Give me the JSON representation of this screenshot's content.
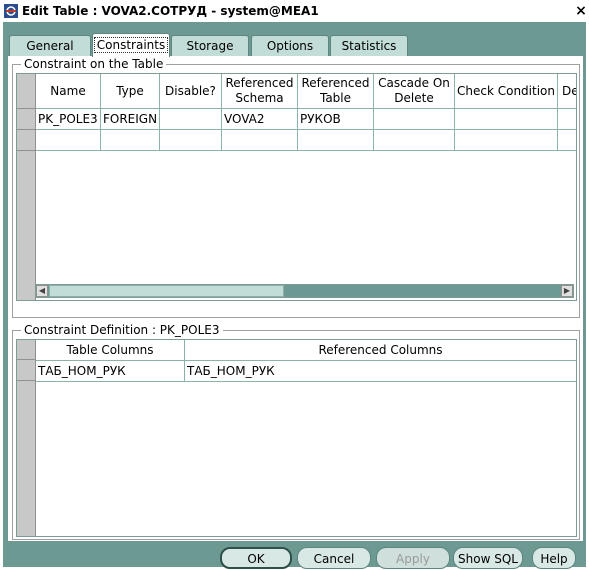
{
  "window": {
    "title": "Edit Table : VOVA2.СОТРУД - system@MEA1",
    "close_glyph": "×"
  },
  "tabs": [
    {
      "label": "General",
      "active": false
    },
    {
      "label": "Constraints",
      "active": true
    },
    {
      "label": "Storage",
      "active": false
    },
    {
      "label": "Options",
      "active": false
    },
    {
      "label": "Statistics",
      "active": false
    }
  ],
  "constraints_group": {
    "legend": "Constraint on the Table",
    "columns": [
      "Name",
      "Type",
      "Disable?",
      "Referenced Schema",
      "Referenced Table",
      "Cascade On Delete",
      "Check Condition",
      "De"
    ],
    "rows": [
      [
        "PK_POLE3",
        "FOREIGN",
        "",
        "VOVA2",
        "РУКОВ",
        "",
        "",
        ""
      ],
      [
        "",
        "",
        "",
        "",
        "",
        "",
        "",
        ""
      ]
    ]
  },
  "definition_group": {
    "legend": "Constraint Definition : PK_POLE3",
    "columns": [
      "Table Columns",
      "Referenced Columns"
    ],
    "rows": [
      [
        "ТАБ_НОМ_РУК",
        "ТАБ_НОМ_РУК"
      ]
    ]
  },
  "buttons": {
    "ok": "OK",
    "cancel": "Cancel",
    "apply": "Apply",
    "show_sql": "Show SQL",
    "help": "Help"
  },
  "colors": {
    "accent": "#6c9a92",
    "tab_bg": "#c2ddd7",
    "grid_line": "#8ab3ac"
  },
  "icons": {
    "app": "oracle-app-icon",
    "close": "close-icon",
    "scroll_left": "arrow-left-icon",
    "scroll_right": "arrow-right-icon"
  }
}
